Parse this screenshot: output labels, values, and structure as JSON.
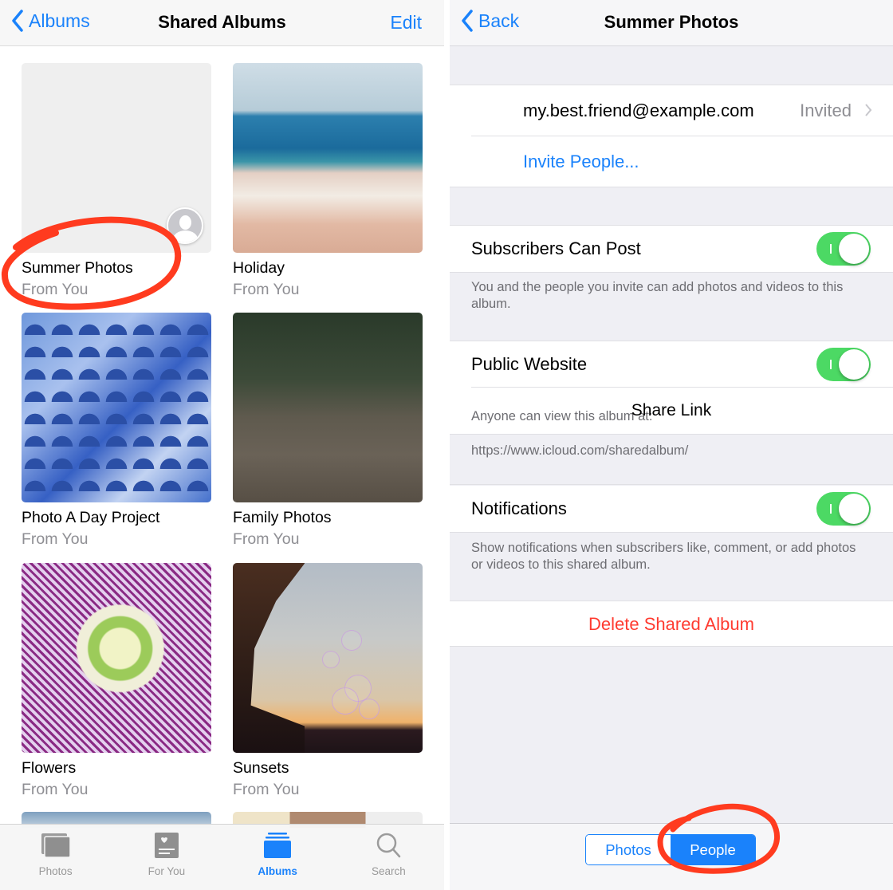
{
  "left_screen": {
    "navbar": {
      "back_label": "Albums",
      "title": "Shared Albums",
      "edit_label": "Edit"
    },
    "albums": [
      {
        "name": "Summer Photos",
        "subtitle": "From You",
        "thumb": "empty-with-avatar"
      },
      {
        "name": "Holiday",
        "subtitle": "From You",
        "thumb": "beach"
      },
      {
        "name": "Photo A Day Project",
        "subtitle": "From You",
        "thumb": "blue-tiles"
      },
      {
        "name": "Family Photos",
        "subtitle": "From You",
        "thumb": "children-on-steps"
      },
      {
        "name": "Flowers",
        "subtitle": "From You",
        "thumb": "purple-flower"
      },
      {
        "name": "Sunsets",
        "subtitle": "From You",
        "thumb": "sunset-bubbles"
      }
    ],
    "tabbar": {
      "tabs": [
        {
          "label": "Photos",
          "icon": "photos-icon",
          "active": false
        },
        {
          "label": "For You",
          "icon": "for-you-icon",
          "active": false
        },
        {
          "label": "Albums",
          "icon": "albums-icon",
          "active": true
        },
        {
          "label": "Search",
          "icon": "search-icon",
          "active": false
        }
      ]
    }
  },
  "right_screen": {
    "navbar": {
      "back_label": "Back",
      "title": "Summer Photos"
    },
    "people": {
      "invitee_email": "my.best.friend@example.com",
      "invitee_status": "Invited",
      "invite_label": "Invite People..."
    },
    "subscribers_can_post": {
      "label": "Subscribers Can Post",
      "on": true,
      "footer": "You and the people you invite can add photos and videos to this album."
    },
    "public_website": {
      "label": "Public Website",
      "on": true,
      "anyone_text": "Anyone can view this album at:",
      "share_link_label": "Share Link",
      "url": "https://www.icloud.com/sharedalbum/"
    },
    "notifications": {
      "label": "Notifications",
      "on": true,
      "footer": "Show notifications when subscribers like, comment, or add photos or videos to this shared album."
    },
    "delete_label": "Delete Shared Album",
    "segmented": {
      "options": [
        "Photos",
        "People"
      ],
      "selected": "People"
    }
  },
  "colors": {
    "accent": "#1a82fb",
    "toggle_on": "#4cd964",
    "destructive": "#ff3b30",
    "annotation": "#ff3b1f",
    "secondary_text": "#8e8e93"
  }
}
